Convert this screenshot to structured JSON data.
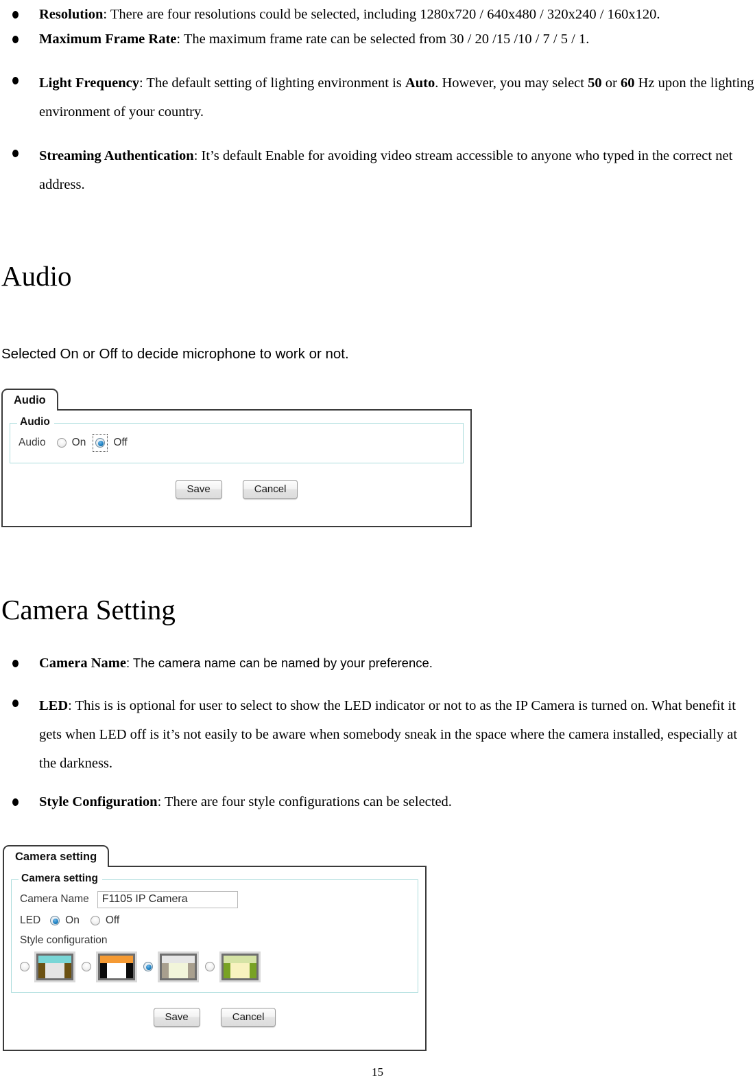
{
  "document": {
    "bullets_top": [
      {
        "term": "Resolution",
        "rest": ": There are four resolutions could be selected, including 1280x720 / 640x480 / 320x240 / 160x120."
      },
      {
        "term": "Maximum Frame Rate",
        "rest": ": The maximum frame rate can be selected from 30 / 20 /15 /10 / 7 / 5 / 1."
      },
      {
        "term": "Light Frequency",
        "rest": ": The default setting of lighting environment is Auto. However, you may select 50 or 60 Hz upon the lighting environment of your country."
      },
      {
        "term": "Streaming Authentication",
        "rest": ": It’s default Enable for avoiding video stream accessible to anyone who typed in the correct net address."
      }
    ],
    "light_frequency": {
      "term": "Light Frequency",
      "p1": ": The default setting of lighting environment is ",
      "b1": "Auto",
      "p2": ". However, you may select ",
      "b2": "50",
      "p3": " or ",
      "b3": "60",
      "p4": " Hz upon the lighting environment of your country."
    },
    "audio_heading": "Audio",
    "audio_intro": "Selected On or Off to decide microphone to work or not.",
    "camera_heading": "Camera Setting",
    "bullets_camera": [
      {
        "term": "Camera Name",
        "rest": ": The camera name can be named by your preference."
      },
      {
        "term": "LED",
        "rest": ": This is is optional for user to select to show the LED indicator or not to as the IP Camera is turned on. What benefit it gets when LED off is it’s not easily to be aware when somebody sneak in the space where the camera installed, especially at the darkness."
      },
      {
        "term": "Style Configuration",
        "rest": ": There are four style configurations can be selected."
      }
    ],
    "page_number": "15"
  },
  "audio_panel": {
    "tab_label": "Audio",
    "fieldset_legend": "Audio",
    "field_label": "Audio",
    "option_on": "On",
    "option_off": "Off",
    "selected": "Off",
    "save_label": "Save",
    "cancel_label": "Cancel"
  },
  "camera_panel": {
    "tab_label": "Camera setting",
    "fieldset_legend": "Camera setting",
    "camera_name_label": "Camera Name",
    "camera_name_value": "F1105 IP Camera",
    "led_label": "LED",
    "led_on": "On",
    "led_off": "Off",
    "led_selected": "On",
    "style_label": "Style configuration",
    "style_selected_index": 2,
    "styles": [
      {
        "name": "style-1",
        "top": "#79d6d6",
        "side": "#6b5112",
        "center": "#e4e4e4",
        "frame": "#6e6e6e"
      },
      {
        "name": "style-2",
        "top": "#f59a33",
        "side": "#0b0b0b",
        "center": "#ffffff",
        "frame": "#6e6e6e"
      },
      {
        "name": "style-3",
        "top": "#e6e6e6",
        "side": "#a89f8e",
        "center": "#f2f5da",
        "frame": "#6e6e6e"
      },
      {
        "name": "style-4",
        "top": "#d5e3a5",
        "side": "#78a224",
        "center": "#f8f2bf",
        "frame": "#6e6e6e"
      }
    ],
    "save_label": "Save",
    "cancel_label": "Cancel"
  },
  "colors": {
    "panel_border": "#3a3a3a",
    "fieldset_border": "#aadcdc",
    "radio_accent": "#1a7fc1"
  }
}
